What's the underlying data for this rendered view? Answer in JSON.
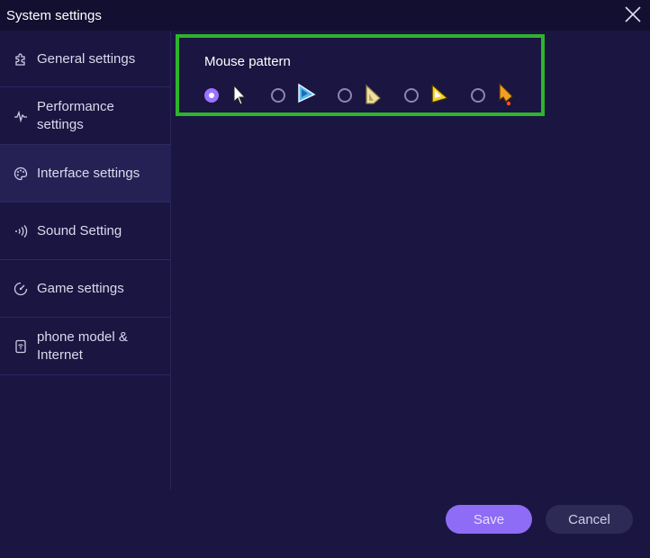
{
  "window": {
    "title": "System settings"
  },
  "sidebar": {
    "items": [
      {
        "label": "General settings",
        "icon": "puzzle-icon",
        "active": false
      },
      {
        "label": "Performance settings",
        "icon": "pulse-icon",
        "active": false
      },
      {
        "label": "Interface settings",
        "icon": "palette-icon",
        "active": true
      },
      {
        "label": "Sound Setting",
        "icon": "sound-wave-icon",
        "active": false
      },
      {
        "label": "Game settings",
        "icon": "gamepad-icon",
        "active": false
      },
      {
        "label": "phone model & Internet",
        "icon": "wifi-phone-icon",
        "active": false
      }
    ]
  },
  "main": {
    "mouse_pattern": {
      "title": "Mouse pattern",
      "selected_index": 0,
      "options": [
        {
          "icon": "white-arrow-cursor-icon"
        },
        {
          "icon": "blue-arrow-cursor-icon"
        },
        {
          "icon": "cream-arrow-cursor-icon"
        },
        {
          "icon": "yellow-arrow-cursor-icon"
        },
        {
          "icon": "orange-dot-arrow-cursor-icon"
        }
      ]
    }
  },
  "footer": {
    "save_label": "Save",
    "cancel_label": "Cancel"
  },
  "colors": {
    "background": "#1a1541",
    "titlebar": "#120f31",
    "accent": "#8e6cf5",
    "highlight_border": "#2db52b"
  }
}
